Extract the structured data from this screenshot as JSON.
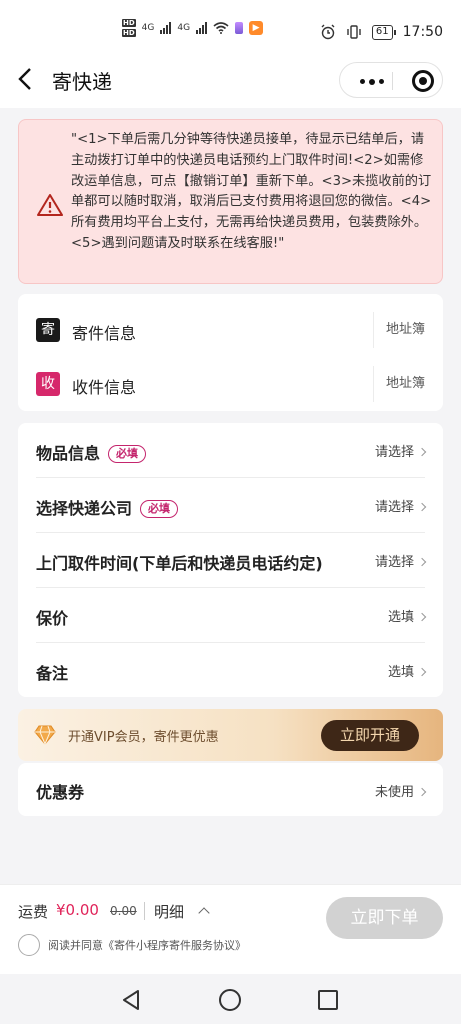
{
  "status_bar": {
    "time": "17:50",
    "battery": "61",
    "network1": "4G",
    "network2": "4G"
  },
  "nav": {
    "title": "寄快递"
  },
  "notice": {
    "text": "\"<1>下单后需几分钟等待快递员接单，待显示已结单后，请主动拨打订单中的快递员电话预约上门取件时间!<2>如需修改运单信息，可点【撤销订单】重新下单。<3>未揽收前的订单都可以随时取消，取消后已支付费用将退回您的微信。<4>所有费用均平台上支付，无需再给快递员费用，包装费除外。<5>遇到问题请及时联系在线客服!\""
  },
  "address": {
    "sender": {
      "badge": "寄",
      "label": "寄件信息",
      "book": "地址簿",
      "badge_color": "#1a1a1a"
    },
    "receiver": {
      "badge": "收",
      "label": "收件信息",
      "book": "地址簿",
      "badge_color": "#d6286b"
    }
  },
  "form": {
    "required_tag": "必填",
    "rows": [
      {
        "label": "物品信息",
        "value": "请选择",
        "required": true
      },
      {
        "label": "选择快递公司",
        "value": "请选择",
        "required": true
      },
      {
        "label": "上门取件时间(下单后和快递员电话约定)",
        "value": "请选择",
        "required": false
      },
      {
        "label": "保价",
        "value": "选填",
        "required": false
      },
      {
        "label": "备注",
        "value": "选填",
        "required": false
      }
    ]
  },
  "vip": {
    "text": "开通VIP会员，寄件更优惠",
    "button": "立即开通",
    "icon": "diamond-icon"
  },
  "coupon": {
    "label": "优惠券",
    "value": "未使用"
  },
  "footer": {
    "fee_label": "运费",
    "fee_amount": "¥0.00",
    "fee_original": "0.00",
    "detail": "明细",
    "agreement": "阅读并同意《寄件小程序寄件服务协议》",
    "submit": "立即下单"
  },
  "colors": {
    "accent": "#d6286b",
    "notice_bg": "#fde2e2",
    "vip_button": "#3e2717",
    "disabled": "#d2d2d2"
  }
}
